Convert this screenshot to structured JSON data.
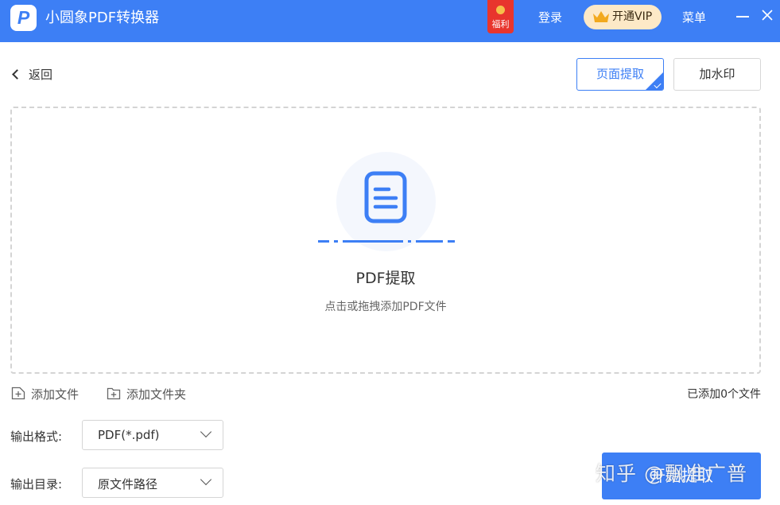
{
  "titlebar": {
    "app_title": "小圆象PDF转换器",
    "logo_letter": "P",
    "gift_label": "福利",
    "login": "登录",
    "vip": "开通VIP",
    "menu": "菜单"
  },
  "nav": {
    "back": "返回"
  },
  "functions": [
    {
      "label": "页面提取",
      "active": true
    },
    {
      "label": "加水印",
      "active": false
    }
  ],
  "dropzone": {
    "title": "PDF提取",
    "subtitle": "点击或拖拽添加PDF文件"
  },
  "actions": {
    "add_file": "添加文件",
    "add_folder": "添加文件夹",
    "added_count": "已添加0个文件"
  },
  "output": {
    "format_label": "输出格式:",
    "format_value": "PDF(*.pdf)",
    "dir_label": "输出目录:",
    "dir_value": "原文件路径"
  },
  "start_button": "开始提取",
  "watermark": "知乎 @飘准广普",
  "colors": {
    "accent": "#3d7ff5",
    "vip_bg": "#fde9c7",
    "gift_red": "#e8352d"
  },
  "icons": [
    "app-logo-icon",
    "gift-icon",
    "crown-icon",
    "minimize-icon",
    "close-icon",
    "back-chevron-icon",
    "document-icon",
    "add-file-icon",
    "add-folder-icon",
    "chevron-down-icon",
    "check-icon"
  ]
}
